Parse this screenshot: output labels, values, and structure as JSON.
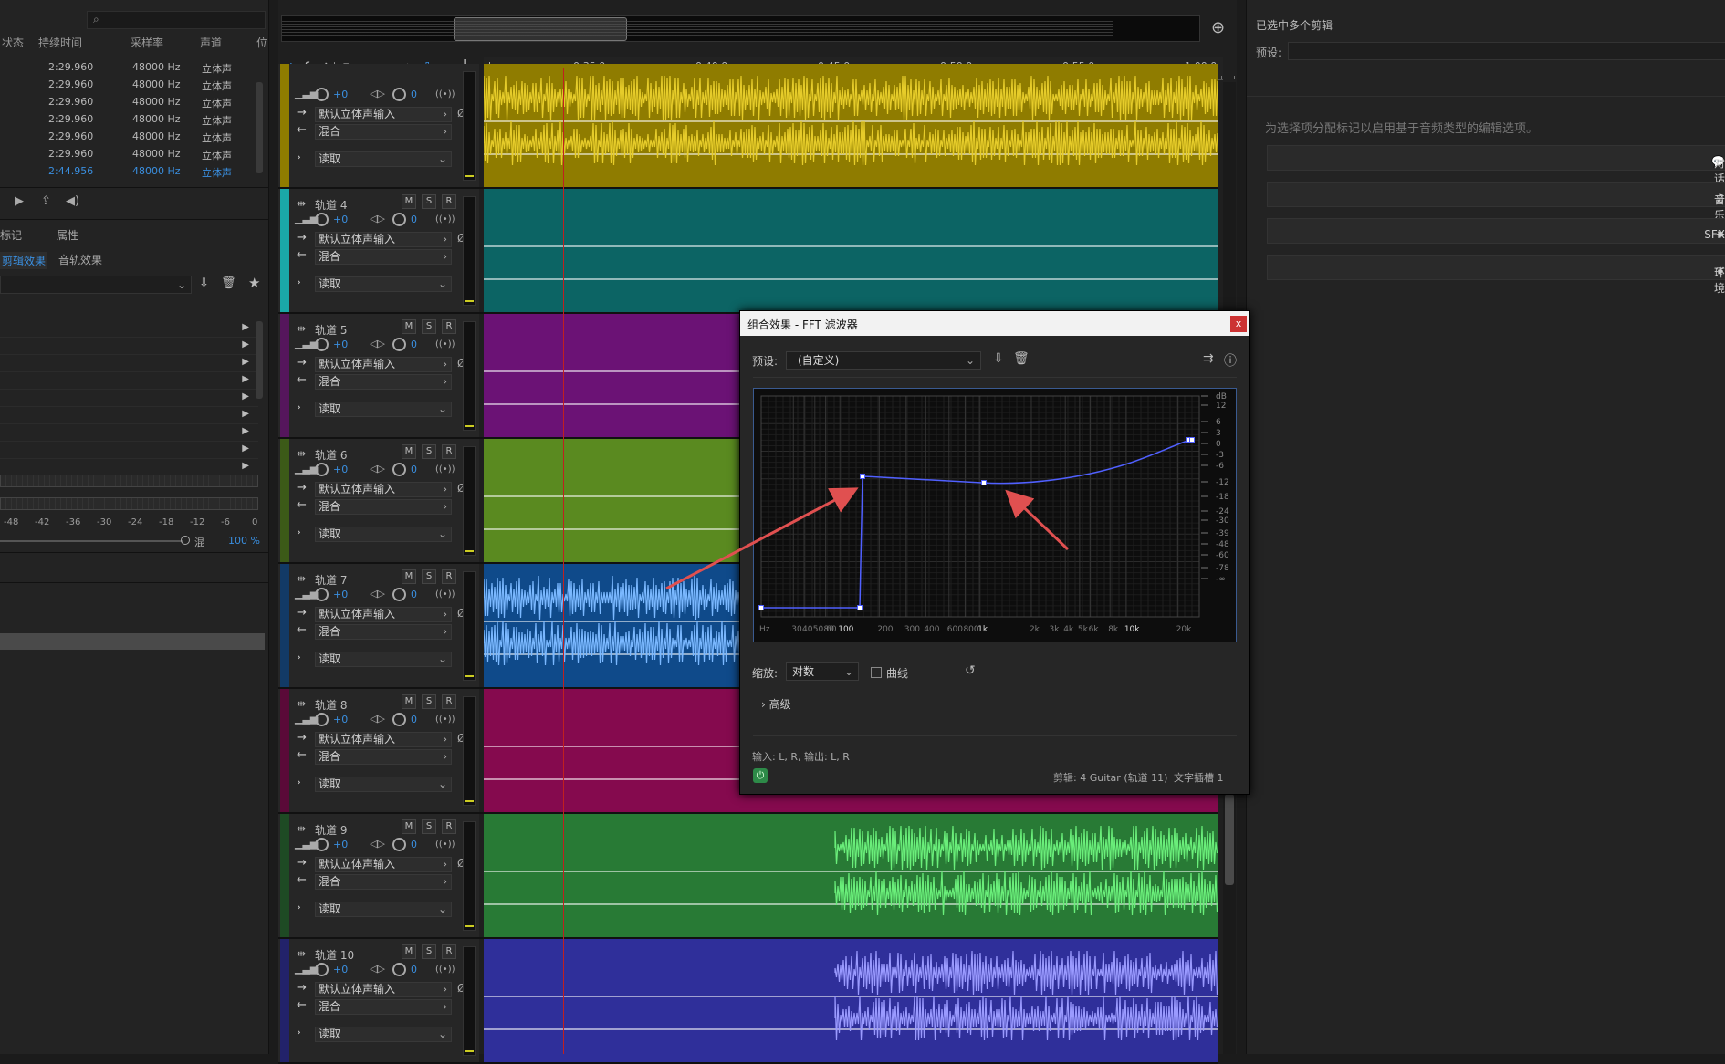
{
  "files_panel": {
    "search_placeholder": "",
    "columns": [
      "状态",
      "持续时间",
      "采样率",
      "声道",
      "位"
    ],
    "rows": [
      {
        "duration": "2:29.960",
        "rate": "48000 Hz",
        "channels": "立体声"
      },
      {
        "duration": "2:29.960",
        "rate": "48000 Hz",
        "channels": "立体声"
      },
      {
        "duration": "2:29.960",
        "rate": "48000 Hz",
        "channels": "立体声"
      },
      {
        "duration": "2:29.960",
        "rate": "48000 Hz",
        "channels": "立体声"
      },
      {
        "duration": "2:29.960",
        "rate": "48000 Hz",
        "channels": "立体声"
      },
      {
        "duration": "2:29.960",
        "rate": "48000 Hz",
        "channels": "立体声"
      },
      {
        "duration": "2:44.956",
        "rate": "48000 Hz",
        "channels": "立体声"
      }
    ]
  },
  "left_tabs": {
    "markers": "标记",
    "properties": "属性"
  },
  "effects_tabs": {
    "clip": "剪辑效果",
    "track": "音轨效果"
  },
  "meter_scale": [
    "-48",
    "-42",
    "-36",
    "-30",
    "-24",
    "-18",
    "-12",
    "-6",
    "0"
  ],
  "mix": {
    "label": "混",
    "value": "100 %"
  },
  "ruler": {
    "unit": "hms",
    "ticks": [
      "0:35.0",
      "0:40.0",
      "0:45.0",
      "0:50.0",
      "0:55.0",
      "1:00.0"
    ]
  },
  "track_common": {
    "volume": "+0",
    "pan": "0",
    "input": "默认立体声输入",
    "output": "混合",
    "mode": "读取",
    "m": "M",
    "s": "S",
    "r": "R"
  },
  "tracks": [
    {
      "name": "",
      "color": "#8f7c00",
      "stripe": "#8f7c00",
      "wave": "#e6cc2a"
    },
    {
      "name": "轨道 4",
      "color": "#0c6464",
      "stripe": "#1aa8a8",
      "wave": ""
    },
    {
      "name": "轨道 5",
      "color": "#6b1275",
      "stripe": "#55165c",
      "wave": ""
    },
    {
      "name": "轨道 6",
      "color": "#5a8a20",
      "stripe": "#3c5a18",
      "wave": ""
    },
    {
      "name": "轨道 7",
      "color": "#0f4a8a",
      "stripe": "#123a66",
      "wave": "#7ab8ff"
    },
    {
      "name": "轨道 8",
      "color": "#850a4e",
      "stripe": "#5a0a38",
      "wave": ""
    },
    {
      "name": "轨道 9",
      "color": "#287a35",
      "stripe": "#1e4a24",
      "wave": "#6aee7a"
    },
    {
      "name": "轨道 10",
      "color": "#2f2f9a",
      "stripe": "#22226a",
      "wave": "#9a9aff"
    }
  ],
  "right_panel": {
    "title": "已选中多个剪辑",
    "preset_label": "预设:",
    "hint": "为选择项分配标记以启用基于音频类型的编辑选项。",
    "options": [
      "对话",
      "音乐",
      "SFX",
      "环境"
    ]
  },
  "dialog": {
    "title": "组合效果 - FFT 滤波器",
    "close": "x",
    "preset_label": "预设:",
    "preset_value": "(自定义)",
    "db_labels": [
      "dB",
      "12",
      "6",
      "3",
      "0",
      "-3",
      "-6",
      "-12",
      "-18",
      "-24",
      "-30",
      "-39",
      "-48",
      "-60",
      "-78",
      "-∞"
    ],
    "hz_labels": [
      "Hz",
      "30",
      "40",
      "50 60",
      "80",
      "100",
      "200",
      "300",
      "400",
      "600",
      "800",
      "1k",
      "2k",
      "3k",
      "4k",
      "5k",
      "6k",
      "8k",
      "10k",
      "20k"
    ],
    "scale_label": "缩放:",
    "scale_value": "对数",
    "curve_label": "曲线",
    "advanced": "高级",
    "io": "输入: L, R, 输出: L, R",
    "clip_info": "剪辑: 4 Guitar (轨道 11)",
    "slot": "文字插槽 1"
  }
}
